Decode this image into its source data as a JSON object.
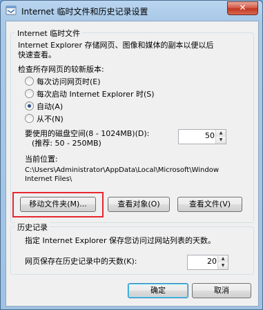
{
  "window": {
    "title": "Internet 临时文件和历史记录设置",
    "close_label": "✕"
  },
  "temp_files": {
    "group_title": "Internet 临时文件",
    "description_line1": "Internet Explorer 存储网页、图像和媒体的副本以便以后",
    "description_line2": "快速查看。",
    "check_label": "检查所存网页的较新版本:",
    "options": [
      {
        "label": "每次访问网页时(E)",
        "selected": false
      },
      {
        "label": "每次启动 Internet Explorer 时(S)",
        "selected": false
      },
      {
        "label": "自动(A)",
        "selected": true
      },
      {
        "label": "从不(N)",
        "selected": false
      }
    ],
    "disk_space_label": "要使用的磁盘空间(8 - 1024MB)(D):",
    "disk_space_hint": "(推荐: 50 - 250MB)",
    "disk_space_value": "50",
    "current_location_label": "当前位置:",
    "path_line1": "C:\\Users\\Administrator\\AppData\\Local\\Microsoft\\Window",
    "path_line2": "Internet Files\\",
    "move_folder_button": "移动文件夹(M)...",
    "view_objects_button": "查看对象(O)",
    "view_files_button": "查看文件(V)"
  },
  "history": {
    "group_title": "历史记录",
    "description": "指定 Internet Explorer 保存您访问过网站列表的天数。",
    "days_label": "网页保存在历史记录中的天数(K):",
    "days_value": "20"
  },
  "footer": {
    "ok_button": "确定",
    "cancel_button": "取消"
  },
  "icons": {
    "spin_up": "▲",
    "spin_down": "▼"
  },
  "colors": {
    "highlight": "#e8262e",
    "close_button": "#c23520"
  }
}
